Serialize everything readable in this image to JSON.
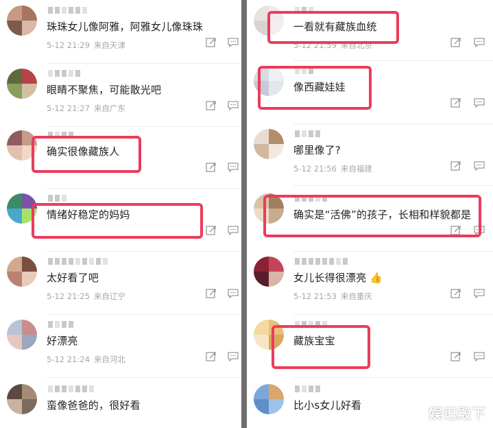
{
  "colors": {
    "highlight": "#ec3b5a",
    "text": "#222222",
    "meta": "#a7a7a7"
  },
  "left_comments": [
    {
      "text": "珠珠女儿像阿雅，阿雅女儿像珠珠",
      "time": "5-12 21:29",
      "location": "来自天津"
    },
    {
      "text": "眼睛不聚焦，可能散光吧",
      "time": "5-12 21:27",
      "location": "来自广东"
    },
    {
      "text": "确实很像藏族人",
      "time": "",
      "location": ""
    },
    {
      "text": "情绪好稳定的妈妈",
      "time": "",
      "location": ""
    },
    {
      "text": "太好看了吧",
      "time": "5-12 21:25",
      "location": "来自辽宁"
    },
    {
      "text": "好漂亮",
      "time": "5-12 21:24",
      "location": "来自河北"
    },
    {
      "text": "蛮像爸爸的，很好看",
      "time": "",
      "location": ""
    }
  ],
  "right_comments": [
    {
      "text": "一看就有藏族血统",
      "time": "5-12 21:59",
      "location": "来自北京"
    },
    {
      "text": "像西藏娃娃",
      "time": "",
      "location": ""
    },
    {
      "text": "哪里像了?",
      "time": "5-12 21:56",
      "location": "来自福建"
    },
    {
      "text": "确实是“活佛”的孩子，长相和样貌都是",
      "time": "",
      "location": ""
    },
    {
      "text": "女儿长得很漂亮 👍",
      "time": "5-12 21:53",
      "location": "来自重庆"
    },
    {
      "text": "藏族宝宝",
      "time": "",
      "location": ""
    },
    {
      "text": "比小s女儿好看",
      "time": "",
      "location": ""
    }
  ],
  "watermark": "娱记殿下"
}
